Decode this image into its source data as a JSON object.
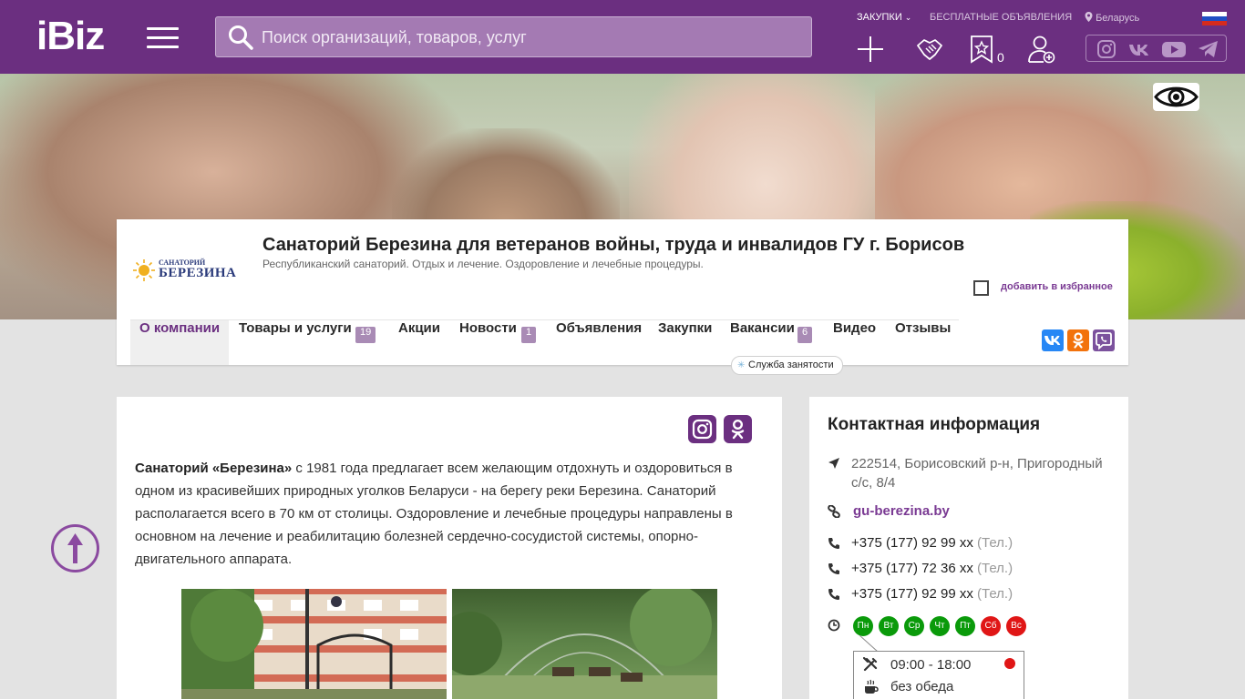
{
  "header": {
    "logo": "iBiz",
    "search_placeholder": "Поиск организаций, товаров, услуг",
    "links": {
      "purchases": "ЗАКУПКИ",
      "free_ads": "БЕСПЛАТНЫЕ ОБЪЯВЛЕНИЯ",
      "region": "Беларусь"
    },
    "favorites_count": "0",
    "colors": {
      "bar": "#6b2f80",
      "accent": "#7a3a93"
    }
  },
  "company": {
    "logo_line1": "САНАТОРИЙ",
    "logo_line2": "БЕРЕЗИНА",
    "title": "Санаторий Березина для ветеранов войны, труда и инвалидов ГУ г. Борисов",
    "subtitle": "Республиканский санаторий. Отдых и лечение. Оздоровление и лечебные процедуры.",
    "add_favorite": "добавить в избранное"
  },
  "tabs": [
    {
      "label": "О компании"
    },
    {
      "label": "Товары и услуги",
      "badge": "19"
    },
    {
      "label": "Акции"
    },
    {
      "label": "Новости",
      "badge": "1"
    },
    {
      "label": "Объявления"
    },
    {
      "label": "Закупки"
    },
    {
      "label": "Вакансии",
      "badge": "6"
    },
    {
      "label": "Видео"
    },
    {
      "label": "Отзывы"
    }
  ],
  "employment_service": "Служба занятости",
  "about": {
    "bold": "Санаторий «Березина»",
    "text": " с 1981 года предлагает всем желающим отдохнуть и оздоровиться в одном из красивейших природных уголков Беларуси - на берегу реки Березина. Санаторий располагается всего в 70 км от столицы. Оздоровление и лечебные процедуры направлены в основном на лечение и реабилитацию болезней сердечно-сосудистой системы, опорно-двигательного аппарата."
  },
  "contacts": {
    "title": "Контактная информация",
    "address": "222514, Борисовский р-н, Пригородный с/с, 8/4",
    "website": "gu-berezina.by",
    "phones": [
      {
        "number": "+375 (177) 92 99 xx",
        "type": "(Тел.)"
      },
      {
        "number": "+375 (177) 72 36 xx",
        "type": "(Тел.)"
      },
      {
        "number": "+375 (177) 92 99 xx",
        "type": "(Тел.)"
      }
    ],
    "days": [
      {
        "label": "Пн",
        "status": "work"
      },
      {
        "label": "Вт",
        "status": "work"
      },
      {
        "label": "Ср",
        "status": "work"
      },
      {
        "label": "Чт",
        "status": "work"
      },
      {
        "label": "Пт",
        "status": "work"
      },
      {
        "label": "Сб",
        "status": "off"
      },
      {
        "label": "Вс",
        "status": "off"
      }
    ],
    "hours": "09:00 - 18:00",
    "lunch": "без обеда"
  }
}
